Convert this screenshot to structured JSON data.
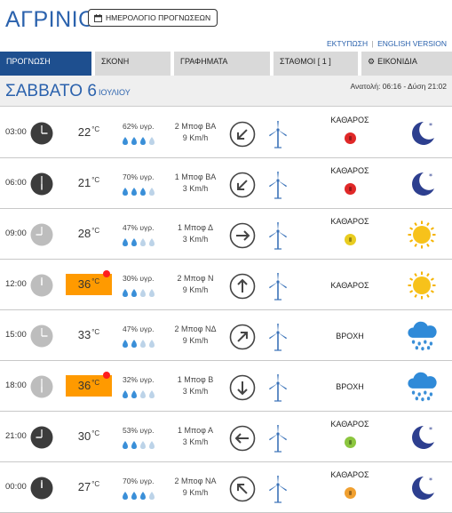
{
  "header": {
    "city": "ΑΓΡΙΝΙΟ",
    "calendar_button": "ΗΜΕΡΟΛΟΓΙΟ ΠΡΟΓΝΩΣΕΩΝ",
    "print_link": "ΕΚΤΥΠΩΣΗ",
    "separator": "|",
    "english_link": "ENGLISH VERSION"
  },
  "tabs": [
    {
      "label": "ΠΡΟΓΝΩΣΗ",
      "active": true
    },
    {
      "label": "ΣΚΟΝΗ",
      "active": false
    },
    {
      "label": "ΓΡΑΦΗΜΑΤΑ",
      "active": false
    },
    {
      "label": "ΣΤΑΘΜΟΙ [ 1 ]",
      "active": false
    },
    {
      "label": "ΕΙΚΟΝΙΔΙΑ",
      "active": false,
      "icon": "gear-icon"
    }
  ],
  "day": {
    "name": "ΣΑΒΒΑΤΟ 6",
    "month": "ΙΟΥΛΙΟΥ",
    "sun": "Ανατολή: 06:16 - Δύση 21:02"
  },
  "colors": {
    "brand_blue": "#2b62ad",
    "active_tab": "#1e4f8f",
    "hot_temp": "#ff9a00",
    "alert_dot": "#ff1d1d",
    "drop_blue": "#3a8fd8"
  },
  "rows": [
    {
      "time": "03:00",
      "clock_style": "dark",
      "temp": "22",
      "unit": "°C",
      "hot": false,
      "humidity": "62% υγρ.",
      "drops_full": 3,
      "wind_bft": "2 Μποφ ΒΑ",
      "wind_kmh": "9 Km/h",
      "wind_dir_deg": 225,
      "wind_icon": "arrow-down-left-icon",
      "sky": "ΚΑΘΑΡΟΣ",
      "aq_color": "#e02828",
      "weather_icon": "moon-icon"
    },
    {
      "time": "06:00",
      "clock_style": "dark",
      "temp": "21",
      "unit": "°C",
      "hot": false,
      "humidity": "70% υγρ.",
      "drops_full": 3,
      "wind_bft": "1 Μποφ ΒΑ",
      "wind_kmh": "3 Km/h",
      "wind_dir_deg": 225,
      "wind_icon": "arrow-down-left-icon",
      "sky": "ΚΑΘΑΡΟΣ",
      "aq_color": "#e02828",
      "weather_icon": "moon-icon"
    },
    {
      "time": "09:00",
      "clock_style": "light",
      "temp": "28",
      "unit": "°C",
      "hot": false,
      "humidity": "47% υγρ.",
      "drops_full": 2,
      "wind_bft": "1 Μποφ Δ",
      "wind_kmh": "3 Km/h",
      "wind_dir_deg": 90,
      "wind_icon": "arrow-right-icon",
      "sky": "ΚΑΘΑΡΟΣ",
      "aq_color": "#e8cc20",
      "weather_icon": "sun-icon"
    },
    {
      "time": "12:00",
      "clock_style": "light",
      "temp": "36",
      "unit": "°C",
      "hot": true,
      "humidity": "30% υγρ.",
      "drops_full": 2,
      "wind_bft": "2 Μποφ Ν",
      "wind_kmh": "9 Km/h",
      "wind_dir_deg": 0,
      "wind_icon": "arrow-up-icon",
      "sky": "ΚΑΘΑΡΟΣ",
      "aq_color": null,
      "weather_icon": "sun-icon"
    },
    {
      "time": "15:00",
      "clock_style": "light",
      "temp": "33",
      "unit": "°C",
      "hot": false,
      "humidity": "47% υγρ.",
      "drops_full": 2,
      "wind_bft": "2 Μποφ ΝΔ",
      "wind_kmh": "9 Km/h",
      "wind_dir_deg": 45,
      "wind_icon": "arrow-up-right-icon",
      "sky": "ΒΡΟΧΗ",
      "aq_color": null,
      "weather_icon": "rain-cloud-icon"
    },
    {
      "time": "18:00",
      "clock_style": "light",
      "temp": "36",
      "unit": "°C",
      "hot": true,
      "humidity": "32% υγρ.",
      "drops_full": 2,
      "wind_bft": "1 Μποφ Β",
      "wind_kmh": "3 Km/h",
      "wind_dir_deg": 180,
      "wind_icon": "arrow-down-icon",
      "sky": "ΒΡΟΧΗ",
      "aq_color": null,
      "weather_icon": "rain-cloud-icon"
    },
    {
      "time": "21:00",
      "clock_style": "dark",
      "temp": "30",
      "unit": "°C",
      "hot": false,
      "humidity": "53% υγρ.",
      "drops_full": 2,
      "wind_bft": "1 Μποφ Α",
      "wind_kmh": "3 Km/h",
      "wind_dir_deg": 270,
      "wind_icon": "arrow-left-icon",
      "sky": "ΚΑΘΑΡΟΣ",
      "aq_color": "#8cc63f",
      "weather_icon": "moon-icon"
    },
    {
      "time": "00:00",
      "clock_style": "dark",
      "temp": "27",
      "unit": "°C",
      "hot": false,
      "humidity": "70% υγρ.",
      "drops_full": 3,
      "wind_bft": "2 Μποφ ΝΑ",
      "wind_kmh": "9 Km/h",
      "wind_dir_deg": 315,
      "wind_icon": "arrow-up-left-icon",
      "sky": "ΚΑΘΑΡΟΣ",
      "aq_color": "#f0a030",
      "weather_icon": "moon-icon"
    }
  ]
}
